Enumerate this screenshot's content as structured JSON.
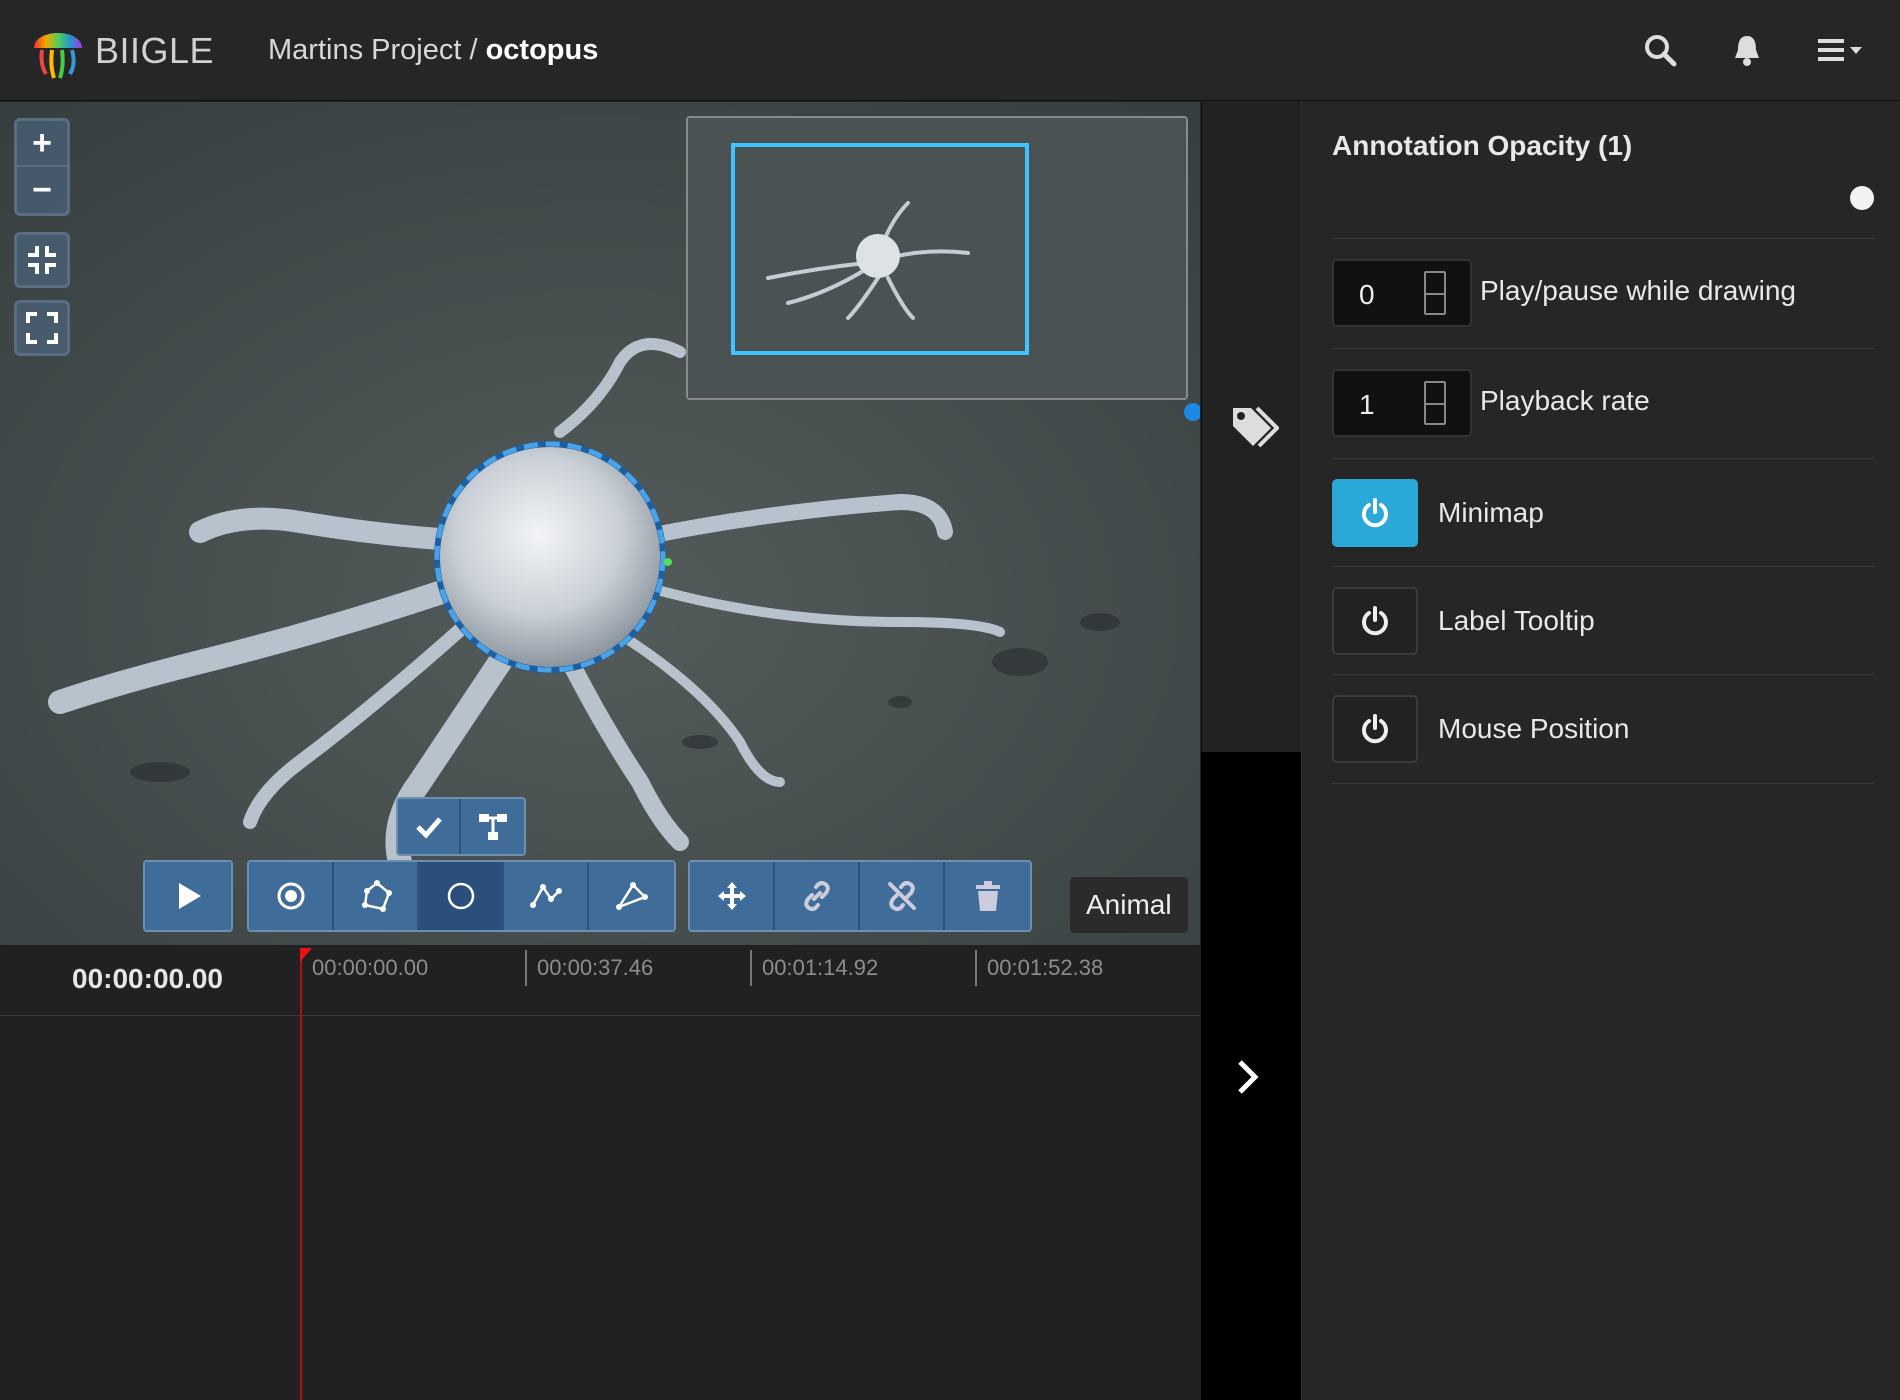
{
  "app": {
    "brand": "BIIGLE"
  },
  "breadcrumb": {
    "project": "Martins Project / ",
    "video": "octopus"
  },
  "nav": {
    "icons": [
      "search-icon",
      "bell-icon",
      "menu-icon"
    ]
  },
  "viewer": {
    "zoom_in": "+",
    "zoom_out": "−",
    "label_chip": "Animal",
    "toolbar_tools": [
      "play",
      "point",
      "polygon",
      "circle",
      "line",
      "whole-frame",
      "move",
      "link",
      "unlink",
      "delete"
    ],
    "active_tool": "circle"
  },
  "timeline": {
    "current_time": "00:00:00.00",
    "ticks": [
      "00:00:00.00",
      "00:00:37.46",
      "00:01:14.92",
      "00:01:52.38"
    ]
  },
  "settings": {
    "opacity_title": "Annotation Opacity (1)",
    "play_pause_value": "0",
    "play_pause_label": "Play/pause while drawing",
    "playback_rate_value": "1",
    "playback_rate_label": "Playback rate",
    "minimap_label": "Minimap",
    "label_tooltip_label": "Label Tooltip",
    "mouse_position_label": "Mouse Position"
  },
  "colors": {
    "accent": "#2aa9d8",
    "tool_blue": "#3f6c98",
    "annotation": "#3a8fd8"
  }
}
